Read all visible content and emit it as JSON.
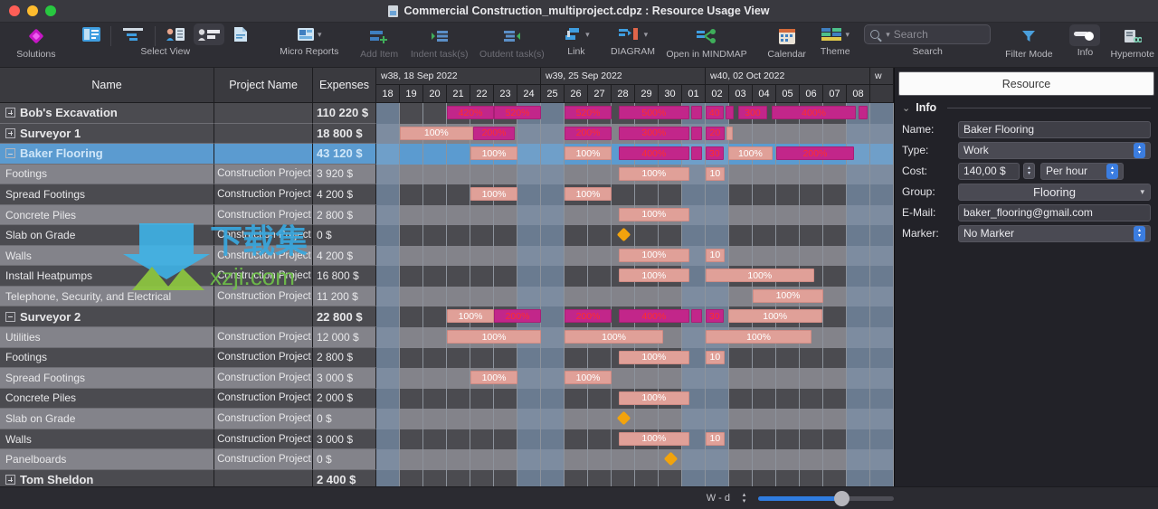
{
  "window": {
    "title": "Commercial Construction_multiproject.cdpz : Resource Usage View",
    "doc_icon": "document-icon"
  },
  "toolbar": {
    "items": [
      {
        "name": "solutions",
        "label": "Solutions",
        "icon": "diamond-icon",
        "dim": false
      },
      {
        "name": "select-view-cards",
        "label": "",
        "icon": "cards-view-icon",
        "dim": false
      },
      {
        "name": "select-view-gantt",
        "label": "",
        "icon": "gantt-view-icon",
        "dim": false
      },
      {
        "name": "select-view-resource-sheet",
        "label": "",
        "icon": "resource-sheet-icon",
        "dim": false
      },
      {
        "name": "select-view-resource-usage",
        "label": "",
        "icon": "resource-usage-icon",
        "dim": false
      },
      {
        "name": "select-view-report",
        "label": "",
        "icon": "report-page-icon",
        "dim": false
      }
    ],
    "select_view_label": "Select View",
    "micro_reports_label": "Micro Reports",
    "add_item_label": "Add Item",
    "indent_label": "Indent task(s)",
    "outdent_label": "Outdent task(s)",
    "link_label": "Link",
    "diagram_label": "DIAGRAM",
    "mindmap_label": "Open in MINDMAP",
    "calendar_label": "Calendar",
    "theme_label": "Theme",
    "search_label": "Search",
    "search_placeholder": "Search",
    "filter_mode_label": "Filter Mode",
    "info_label": "Info",
    "hypernote_label": "Hypernote"
  },
  "grid": {
    "columns": [
      "Name",
      "Project Name",
      "Expenses"
    ],
    "rows": [
      {
        "name": "Bob's Excavation",
        "project": "",
        "expenses": "110 220 $",
        "kind": "group",
        "twisty": "plus",
        "selected": false
      },
      {
        "name": "Surveyor 1",
        "project": "",
        "expenses": "18 800 $",
        "kind": "group",
        "twisty": "plus",
        "selected": false
      },
      {
        "name": "Baker Flooring",
        "project": "",
        "expenses": "43 120 $",
        "kind": "group",
        "twisty": "minus",
        "selected": true
      },
      {
        "name": "Footings",
        "project": "Construction Project",
        "expenses": "3 920 $",
        "kind": "task",
        "twisty": "",
        "selected": false
      },
      {
        "name": "Spread Footings",
        "project": "Construction Project",
        "expenses": "4 200 $",
        "kind": "task",
        "twisty": "",
        "selected": false
      },
      {
        "name": "Concrete Piles",
        "project": "Construction Project",
        "expenses": "2 800 $",
        "kind": "task",
        "twisty": "",
        "selected": false
      },
      {
        "name": "Slab on Grade",
        "project": "Construction Project",
        "expenses": "0 $",
        "kind": "task",
        "twisty": "",
        "selected": false
      },
      {
        "name": "Walls",
        "project": "Construction Project",
        "expenses": "4 200 $",
        "kind": "task",
        "twisty": "",
        "selected": false
      },
      {
        "name": "Install Heatpumps",
        "project": "Construction Project",
        "expenses": "16 800 $",
        "kind": "task",
        "twisty": "",
        "selected": false
      },
      {
        "name": "Telephone, Security, and Electrical",
        "project": "Construction Project",
        "expenses": "11 200 $",
        "kind": "task",
        "twisty": "",
        "selected": false
      },
      {
        "name": "Surveyor 2",
        "project": "",
        "expenses": "22 800 $",
        "kind": "group",
        "twisty": "minus",
        "selected": false
      },
      {
        "name": "Utilities",
        "project": "Construction Project",
        "expenses": "12 000 $",
        "kind": "task",
        "twisty": "",
        "selected": false
      },
      {
        "name": "Footings",
        "project": "Construction Project",
        "expenses": "2 800 $",
        "kind": "task",
        "twisty": "",
        "selected": false
      },
      {
        "name": "Spread Footings",
        "project": "Construction Project",
        "expenses": "3 000 $",
        "kind": "task",
        "twisty": "",
        "selected": false
      },
      {
        "name": "Concrete Piles",
        "project": "Construction Project",
        "expenses": "2 000 $",
        "kind": "task",
        "twisty": "",
        "selected": false
      },
      {
        "name": "Slab on Grade",
        "project": "Construction Project",
        "expenses": "0 $",
        "kind": "task",
        "twisty": "",
        "selected": false
      },
      {
        "name": "Walls",
        "project": "Construction Project",
        "expenses": "3 000 $",
        "kind": "task",
        "twisty": "",
        "selected": false
      },
      {
        "name": "Panelboards",
        "project": "Construction Project",
        "expenses": "0 $",
        "kind": "task",
        "twisty": "",
        "selected": false
      },
      {
        "name": "Tom Sheldon",
        "project": "",
        "expenses": "2 400 $",
        "kind": "group",
        "twisty": "plus",
        "selected": false
      }
    ]
  },
  "timeline": {
    "weeks": [
      {
        "label": "w38, 18 Sep 2022",
        "days": 7
      },
      {
        "label": "w39, 25 Sep 2022",
        "days": 7
      },
      {
        "label": "w40, 02 Oct 2022",
        "days": 7
      },
      {
        "label": "w",
        "days": 1
      }
    ],
    "days": [
      "18",
      "19",
      "20",
      "21",
      "22",
      "23",
      "24",
      "25",
      "26",
      "27",
      "28",
      "29",
      "30",
      "01",
      "02",
      "03",
      "04",
      "05",
      "06",
      "07",
      "08",
      ""
    ],
    "weekend_index": [
      0,
      6,
      7,
      13,
      14,
      20,
      21
    ],
    "bars": [
      {
        "row": 0,
        "items": [
          {
            "start": 3.0,
            "span": 2.0,
            "label": "420%",
            "type": "over"
          },
          {
            "start": 5.0,
            "span": 2.0,
            "label": "520%",
            "type": "over"
          },
          {
            "start": 8.0,
            "span": 2.0,
            "label": "520%",
            "type": "over"
          },
          {
            "start": 10.3,
            "span": 3.0,
            "label": "500%",
            "type": "over"
          },
          {
            "start": 13.4,
            "span": 0.45,
            "label": "",
            "type": "over"
          },
          {
            "start": 14.0,
            "span": 0.75,
            "label": "40",
            "type": "over"
          },
          {
            "start": 14.85,
            "span": 0.35,
            "label": "",
            "type": "over"
          },
          {
            "start": 15.4,
            "span": 1.2,
            "label": "300",
            "type": "over"
          },
          {
            "start": 16.8,
            "span": 3.6,
            "label": "400%",
            "type": "over"
          },
          {
            "start": 20.5,
            "span": 0.4,
            "label": "",
            "type": "over"
          }
        ]
      },
      {
        "row": 1,
        "items": [
          {
            "start": 1.0,
            "span": 3.1,
            "label": "100%",
            "type": "norm"
          },
          {
            "start": 4.1,
            "span": 1.8,
            "label": "200%",
            "type": "over"
          },
          {
            "start": 8.0,
            "span": 2.0,
            "label": "200%",
            "type": "over"
          },
          {
            "start": 10.3,
            "span": 3.0,
            "label": "300%",
            "type": "over"
          },
          {
            "start": 13.4,
            "span": 0.45,
            "label": "",
            "type": "over"
          },
          {
            "start": 14.0,
            "span": 0.8,
            "label": "20",
            "type": "over"
          },
          {
            "start": 14.9,
            "span": 0.25,
            "label": "",
            "type": "norm"
          }
        ]
      },
      {
        "row": 2,
        "items": [
          {
            "start": 4.0,
            "span": 2.0,
            "label": "100%",
            "type": "norm"
          },
          {
            "start": 8.0,
            "span": 2.0,
            "label": "100%",
            "type": "norm"
          },
          {
            "start": 10.3,
            "span": 3.0,
            "label": "400%",
            "type": "over"
          },
          {
            "start": 13.4,
            "span": 0.45,
            "label": "",
            "type": "over"
          },
          {
            "start": 14.0,
            "span": 0.75,
            "label": "30",
            "type": "over"
          },
          {
            "start": 14.95,
            "span": 1.9,
            "label": "100%",
            "type": "norm"
          },
          {
            "start": 17.0,
            "span": 3.3,
            "label": "200%",
            "type": "over"
          }
        ]
      },
      {
        "row": 3,
        "items": [
          {
            "start": 10.3,
            "span": 3.0,
            "label": "100%",
            "type": "norm"
          },
          {
            "start": 14.0,
            "span": 0.8,
            "label": "10",
            "type": "norm"
          }
        ]
      },
      {
        "row": 4,
        "items": [
          {
            "start": 4.0,
            "span": 2.0,
            "label": "100%",
            "type": "norm"
          },
          {
            "start": 8.0,
            "span": 2.0,
            "label": "100%",
            "type": "norm"
          }
        ]
      },
      {
        "row": 5,
        "items": [
          {
            "start": 10.3,
            "span": 3.0,
            "label": "100%",
            "type": "norm"
          }
        ]
      },
      {
        "row": 6,
        "items": [
          {
            "start": 10.0,
            "span": 0.42,
            "label": "",
            "type": "milestone"
          }
        ]
      },
      {
        "row": 7,
        "items": [
          {
            "start": 10.3,
            "span": 3.0,
            "label": "100%",
            "type": "norm"
          },
          {
            "start": 14.0,
            "span": 0.8,
            "label": "10",
            "type": "norm"
          }
        ]
      },
      {
        "row": 8,
        "items": [
          {
            "start": 10.3,
            "span": 3.0,
            "label": "100%",
            "type": "norm"
          },
          {
            "start": 14.0,
            "span": 4.6,
            "label": "100%",
            "type": "norm"
          }
        ]
      },
      {
        "row": 9,
        "items": [
          {
            "start": 16.0,
            "span": 3.0,
            "label": "100%",
            "type": "norm"
          }
        ]
      },
      {
        "row": 10,
        "items": [
          {
            "start": 3.0,
            "span": 2.0,
            "label": "100%",
            "type": "norm"
          },
          {
            "start": 5.0,
            "span": 2.0,
            "label": "200%",
            "type": "over"
          },
          {
            "start": 8.0,
            "span": 2.0,
            "label": "200%",
            "type": "over"
          },
          {
            "start": 10.3,
            "span": 3.0,
            "label": "400%",
            "type": "over"
          },
          {
            "start": 13.4,
            "span": 0.45,
            "label": "",
            "type": "over"
          },
          {
            "start": 14.0,
            "span": 0.75,
            "label": "30",
            "type": "over"
          },
          {
            "start": 14.95,
            "span": 4.0,
            "label": "100%",
            "type": "norm"
          }
        ]
      },
      {
        "row": 11,
        "items": [
          {
            "start": 3.0,
            "span": 4.0,
            "label": "100%",
            "type": "norm"
          },
          {
            "start": 8.0,
            "span": 4.2,
            "label": "100%",
            "type": "norm"
          },
          {
            "start": 14.0,
            "span": 4.5,
            "label": "100%",
            "type": "norm"
          }
        ]
      },
      {
        "row": 12,
        "items": [
          {
            "start": 10.3,
            "span": 3.0,
            "label": "100%",
            "type": "norm"
          },
          {
            "start": 14.0,
            "span": 0.8,
            "label": "10",
            "type": "norm"
          }
        ]
      },
      {
        "row": 13,
        "items": [
          {
            "start": 4.0,
            "span": 2.0,
            "label": "100%",
            "type": "norm"
          },
          {
            "start": 8.0,
            "span": 2.0,
            "label": "100%",
            "type": "norm"
          }
        ]
      },
      {
        "row": 14,
        "items": [
          {
            "start": 10.3,
            "span": 3.0,
            "label": "100%",
            "type": "norm"
          }
        ]
      },
      {
        "row": 15,
        "items": [
          {
            "start": 10.0,
            "span": 0.42,
            "label": "",
            "type": "milestone"
          }
        ]
      },
      {
        "row": 16,
        "items": [
          {
            "start": 10.3,
            "span": 3.0,
            "label": "100%",
            "type": "norm"
          },
          {
            "start": 14.0,
            "span": 0.8,
            "label": "10",
            "type": "norm"
          }
        ]
      },
      {
        "row": 17,
        "items": [
          {
            "start": 12.0,
            "span": 0.42,
            "label": "",
            "type": "milestone"
          }
        ]
      },
      {
        "row": 18,
        "items": []
      }
    ]
  },
  "info_panel": {
    "tab": "Resource",
    "section_title": "Info",
    "fields": {
      "name_label": "Name:",
      "name_value": "Baker Flooring",
      "type_label": "Type:",
      "type_value": "Work",
      "cost_label": "Cost:",
      "cost_value": "140,00 $",
      "cost_unit": "Per hour",
      "group_label": "Group:",
      "group_value": "Flooring",
      "email_label": "E-Mail:",
      "email_value": "baker_flooring@gmail.com",
      "marker_label": "Marker:",
      "marker_value": "No Marker"
    }
  },
  "status_bar": {
    "scale_label": "W - d"
  },
  "colors": {
    "accent_blue": "#5b9bd0",
    "bar_normal": "#e0a098",
    "bar_overload": "#c2268a",
    "milestone": "#f2a30d",
    "slider": "#2f7ce0"
  }
}
